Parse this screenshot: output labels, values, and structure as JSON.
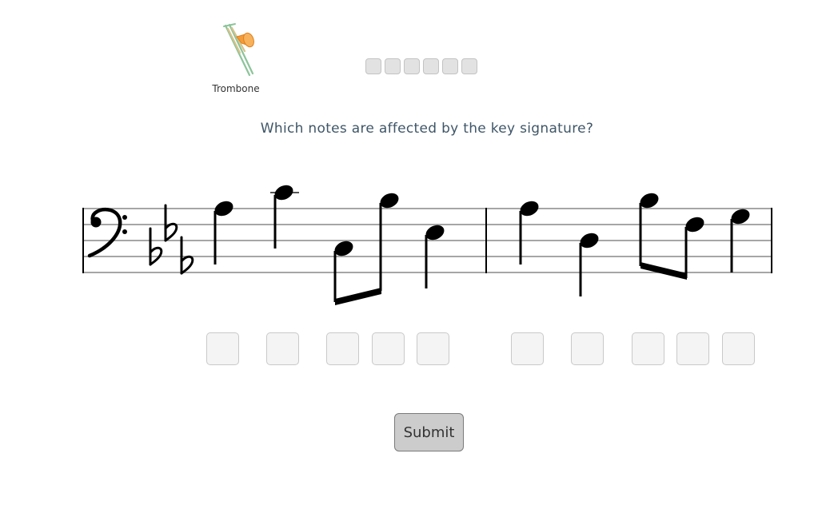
{
  "instrument": {
    "label": "Trombone",
    "icon": "trombone-icon"
  },
  "progress": {
    "total": 6,
    "completed": 0
  },
  "question": "Which notes are affected by the key signature?",
  "staff": {
    "clef": "bass",
    "key_signature": [
      "B-flat",
      "E-flat",
      "A-flat"
    ],
    "measures": [
      {
        "notes": [
          {
            "pitch": "G3",
            "duration": "quarter",
            "stem": "down"
          },
          {
            "pitch": "C4",
            "duration": "quarter",
            "stem": "down",
            "ledger_line": true
          },
          {
            "pitch": "C3",
            "duration": "eighth",
            "stem": "down",
            "beamed": true
          },
          {
            "pitch": "A3",
            "duration": "eighth",
            "stem": "down",
            "beamed": true
          },
          {
            "pitch": "F3",
            "duration": "quarter",
            "stem": "down"
          }
        ]
      },
      {
        "notes": [
          {
            "pitch": "G3",
            "duration": "quarter",
            "stem": "down"
          },
          {
            "pitch": "E3",
            "duration": "quarter",
            "stem": "down"
          },
          {
            "pitch": "A3",
            "duration": "eighth",
            "stem": "down",
            "beamed": true
          },
          {
            "pitch": "F3",
            "duration": "eighth",
            "stem": "down",
            "beamed": true
          },
          {
            "pitch": "G3",
            "duration": "quarter",
            "stem": "down"
          }
        ]
      }
    ]
  },
  "answer_boxes": [
    {
      "measure": 1,
      "note": 1,
      "checked": false
    },
    {
      "measure": 1,
      "note": 2,
      "checked": false
    },
    {
      "measure": 1,
      "note": 3,
      "checked": false
    },
    {
      "measure": 1,
      "note": 4,
      "checked": false
    },
    {
      "measure": 1,
      "note": 5,
      "checked": false
    },
    {
      "measure": 2,
      "note": 1,
      "checked": false
    },
    {
      "measure": 2,
      "note": 2,
      "checked": false
    },
    {
      "measure": 2,
      "note": 3,
      "checked": false
    },
    {
      "measure": 2,
      "note": 4,
      "checked": false
    },
    {
      "measure": 2,
      "note": 5,
      "checked": false
    }
  ],
  "submit": {
    "label": "Submit"
  }
}
